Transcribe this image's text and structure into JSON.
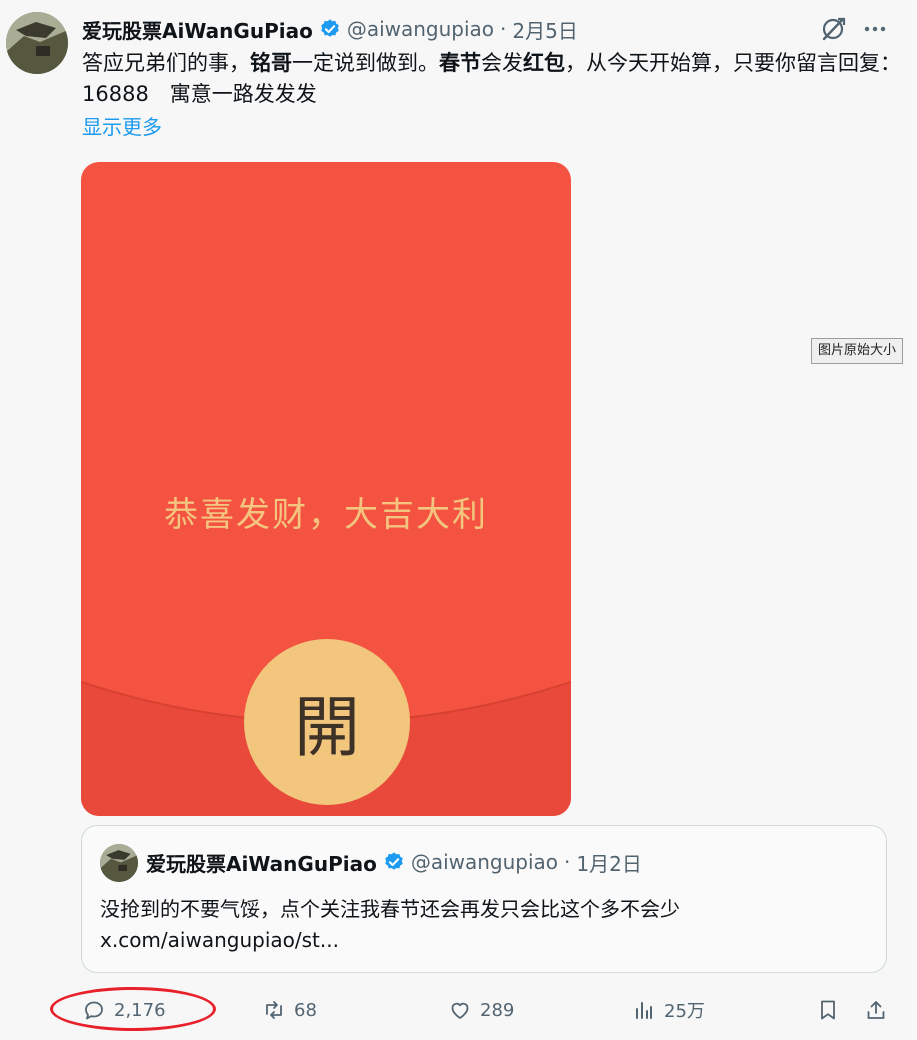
{
  "post": {
    "author_name": "爱玩股票AiWanGuPiao",
    "handle": "@aiwangupiao",
    "separator": "·",
    "date": "2月5日",
    "text_parts": [
      {
        "text": "答应兄弟们的事，"
      },
      {
        "text": "铭哥",
        "bold": true
      },
      {
        "text": "一定说到做到。"
      },
      {
        "text": "春节",
        "bold": true
      },
      {
        "text": "会发"
      },
      {
        "text": "红包",
        "bold": true
      },
      {
        "text": "，从今天开始算，只要你留言回复：16888　寓意一路发发发"
      }
    ],
    "show_more": "显示更多"
  },
  "media": {
    "envelope_text": "恭喜发财，大吉大利",
    "open_char": "開",
    "tooltip": "图片原始大小"
  },
  "quote": {
    "author_name": "爱玩股票AiWanGuPiao",
    "handle": "@aiwangupiao",
    "separator": "·",
    "date": "1月2日",
    "line1": "没抢到的不要气馁，点个关注我春节还会再发只会比这个多不会少",
    "line2": "x.com/aiwangupiao/st..."
  },
  "actions": {
    "replies": "2,176",
    "retweets": "68",
    "likes": "289",
    "views": "25万"
  },
  "icons": [
    "verified-badge-icon",
    "grok-icon",
    "more-icon",
    "reply-icon",
    "retweet-icon",
    "like-icon",
    "views-icon",
    "bookmark-icon",
    "share-icon"
  ],
  "colors": {
    "accent": "#1d9bf0",
    "envelope": "#f45341",
    "envelope_text": "#f3c57f",
    "open_button": "#f2c77d",
    "annotation": "#e8202a"
  }
}
